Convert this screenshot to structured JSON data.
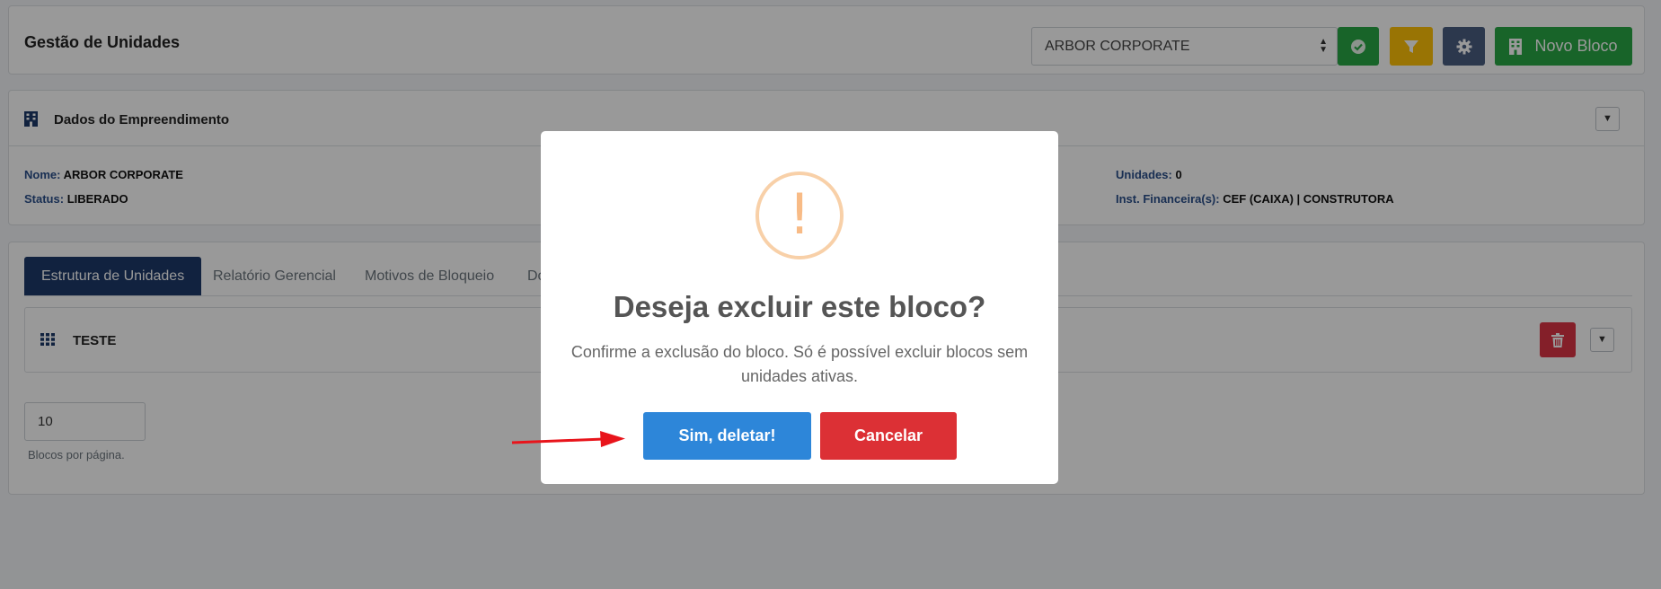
{
  "header": {
    "title": "Gestão de Unidades",
    "select_value": "ARBOR CORPORATE",
    "novo_bloco_label": "Novo Bloco"
  },
  "dados": {
    "title": "Dados do Empreendimento",
    "nome_label": "Nome:",
    "nome_value": "ARBOR CORPORATE",
    "status_label": "Status:",
    "status_value": "LIBERADO",
    "unidades_label": "Unidades:",
    "unidades_value": "0",
    "inst_label": "Inst. Financeira(s):",
    "inst_value": "CEF (CAIXA) | CONSTRUTORA"
  },
  "tabs": [
    {
      "label": "Estrutura de Unidades"
    },
    {
      "label": "Relatório Gerencial"
    },
    {
      "label": "Motivos de Bloqueio"
    },
    {
      "label": "Do"
    }
  ],
  "bloco": {
    "name": "TESTE"
  },
  "pagination": {
    "per_page_value": "10",
    "per_page_label": "Blocos por página."
  },
  "modal": {
    "icon_text": "!",
    "title": "Deseja excluir este bloco?",
    "text": "Confirme a exclusão do bloco. Só é possível excluir blocos sem unidades ativas.",
    "confirm_label": "Sim, deletar!",
    "cancel_label": "Cancelar"
  },
  "colors": {
    "primary_dark": "#1d3a6a",
    "success": "#28a745",
    "warning": "#ffc107",
    "danger": "#dc3545",
    "confirm_blue": "#2d86d9",
    "annotation_arrow": "#e8141b"
  },
  "icons": [
    "check-circle-icon",
    "filter-icon",
    "gear-icon",
    "building-icon",
    "chevron-down-icon",
    "grid-icon",
    "trash-icon",
    "warning-icon"
  ]
}
